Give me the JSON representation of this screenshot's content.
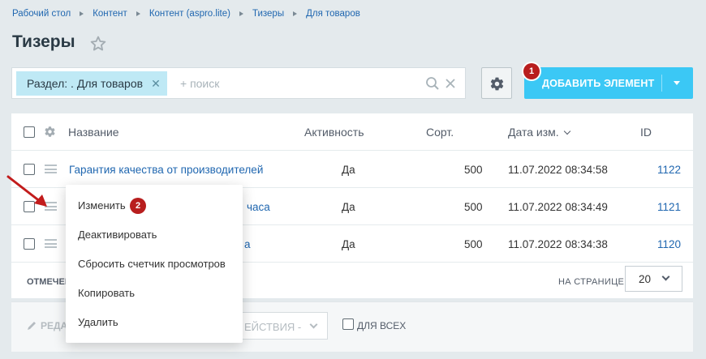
{
  "breadcrumb": [
    "Рабочий стол",
    "Контент",
    "Контент (aspro.lite)",
    "Тизеры",
    "Для товаров"
  ],
  "page_title": "Тизеры",
  "filter": {
    "chip_label": "Раздел: . Для товаров",
    "search_placeholder": "+ поиск"
  },
  "toolbar": {
    "add_button_label": "ДОБАВИТЬ ЭЛЕМЕНТ",
    "step_1": "1",
    "step_2": "2"
  },
  "grid": {
    "columns": {
      "name": "Название",
      "active": "Активность",
      "sort": "Сорт.",
      "date": "Дата изм.",
      "id": "ID"
    },
    "rows": [
      {
        "name": "Гарантия качества от производителей",
        "active": "Да",
        "sort": "500",
        "date": "11.07.2022 08:34:58",
        "id": "1122"
      },
      {
        "name": "часа",
        "active": "Да",
        "sort": "500",
        "date": "11.07.2022 08:34:49",
        "id": "1121"
      },
      {
        "name": "а",
        "active": "Да",
        "sort": "500",
        "date": "11.07.2022 08:34:38",
        "id": "1120"
      }
    ]
  },
  "footer": {
    "selected_label": "ОТМЕЧЕН",
    "per_page_label": "НА СТРАНИЦЕ:",
    "per_page_value": "20"
  },
  "action_panel": {
    "edit_label": "РЕДА",
    "actions_label": "ЕЙСТВИЯ -",
    "for_all_label": "ДЛЯ ВСЕХ"
  },
  "context_menu": {
    "items": [
      "Изменить",
      "Деактивировать",
      "Сбросить счетчик просмотров",
      "Копировать",
      "Удалить"
    ]
  },
  "colors": {
    "accent": "#3bc8f5",
    "link": "#2067b0",
    "badge": "#b81e1e",
    "chip": "#bfe9f5",
    "background": "#e4eaed"
  }
}
